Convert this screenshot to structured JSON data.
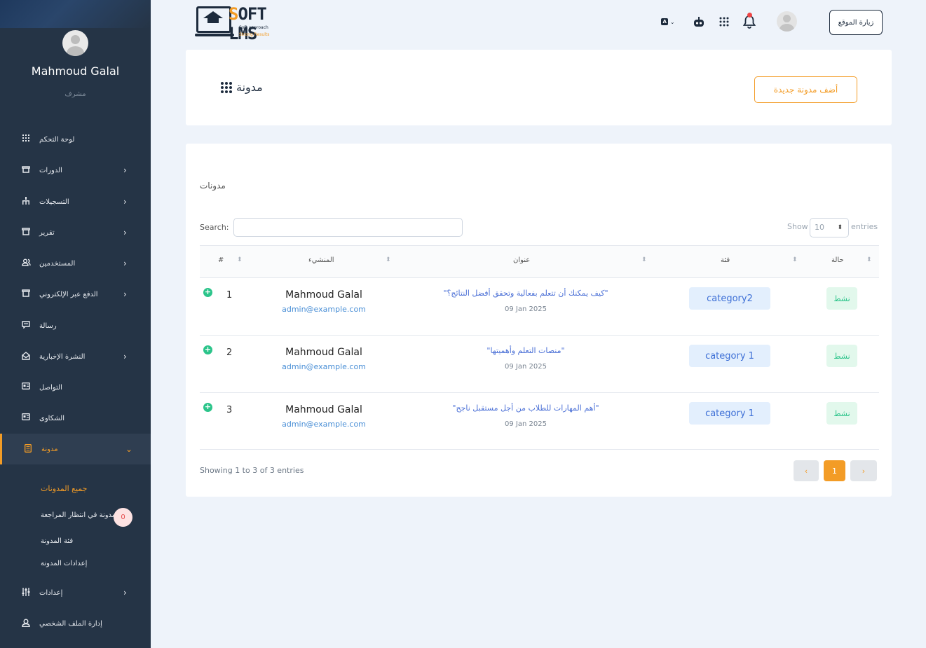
{
  "profile": {
    "name": "Mahmoud Galal",
    "role": "مشرف"
  },
  "sidebar": {
    "items": [
      {
        "label": "لوحة التحكم",
        "icon": "grid-icon",
        "chevron": ""
      },
      {
        "label": "الدورات",
        "icon": "course-icon",
        "chevron": "›"
      },
      {
        "label": "التسجيلات",
        "icon": "sitemap-icon",
        "chevron": "›"
      },
      {
        "label": "تقرير",
        "icon": "report-icon",
        "chevron": "›"
      },
      {
        "label": "المستخدمين",
        "icon": "users-icon",
        "chevron": "›"
      },
      {
        "label": "الدفع عبر الإلكتروني",
        "icon": "payment-icon",
        "chevron": "›"
      },
      {
        "label": "رسالة",
        "icon": "message-icon",
        "chevron": ""
      },
      {
        "label": "النشرة الإخبارية",
        "icon": "newsletter-icon",
        "chevron": "›"
      },
      {
        "label": "التواصل",
        "icon": "contact-icon",
        "chevron": ""
      },
      {
        "label": "الشكاوى",
        "icon": "complaints-icon",
        "chevron": ""
      },
      {
        "label": "مدونة",
        "icon": "blog-icon",
        "chevron": "⌄"
      },
      {
        "label": "إعدادات",
        "icon": "settings-icon",
        "chevron": "›"
      },
      {
        "label": "إدارة الملف الشخصي",
        "icon": "profile-icon",
        "chevron": ""
      }
    ],
    "blog_sub": {
      "all": "جميع المدونات",
      "pending": "مدونة في انتظار المراجعة",
      "pending_count": "0",
      "category": "فئة المدونة",
      "settings": "إعدادات المدونة"
    }
  },
  "header": {
    "logo_brand_s": "S",
    "logo_brand_rest": "OFT LMS",
    "logo_tag1": "Soft approach",
    "logo_tag2": "Strong Results",
    "lang_box": "A",
    "visit_label": "زيارة الموقع"
  },
  "page": {
    "title": "مدونة",
    "add_button": "أضف مدونة جديدة",
    "section_title": "مدونات",
    "search_label": "Search:",
    "show_label": "Show",
    "show_value": "10",
    "entries_label": "entries",
    "columns": {
      "num": "#",
      "author": "المنشيء",
      "title": "عنوان",
      "category": "فئة",
      "status": "حالة"
    },
    "rows": [
      {
        "num": "1",
        "author": "Mahmoud Galal",
        "email": "admin@example.com",
        "title": "\"كيف يمكنك أن تتعلم بفعالية وتحقق أفضل النتائج؟\"",
        "date": "09 Jan 2025",
        "category": "category2",
        "status": "نشط"
      },
      {
        "num": "2",
        "author": "Mahmoud Galal",
        "email": "admin@example.com",
        "title": "\"منصات التعلم وأهميتها\"",
        "date": "09 Jan 2025",
        "category": "category 1",
        "status": "نشط"
      },
      {
        "num": "3",
        "author": "Mahmoud Galal",
        "email": "admin@example.com",
        "title": "\"أهم المهارات للطلاب من أجل مستقبل ناجح\"",
        "date": "09 Jan 2025",
        "category": "category 1",
        "status": "نشط"
      }
    ],
    "footer_info": "Showing 1 to 3 of 3 entries",
    "pagination": {
      "prev": "‹",
      "current": "1",
      "next": "›"
    }
  },
  "colors": {
    "accent": "#f39c26",
    "sidebar": "#253446",
    "success": "#2bc48a",
    "link": "#4a8fd6"
  }
}
